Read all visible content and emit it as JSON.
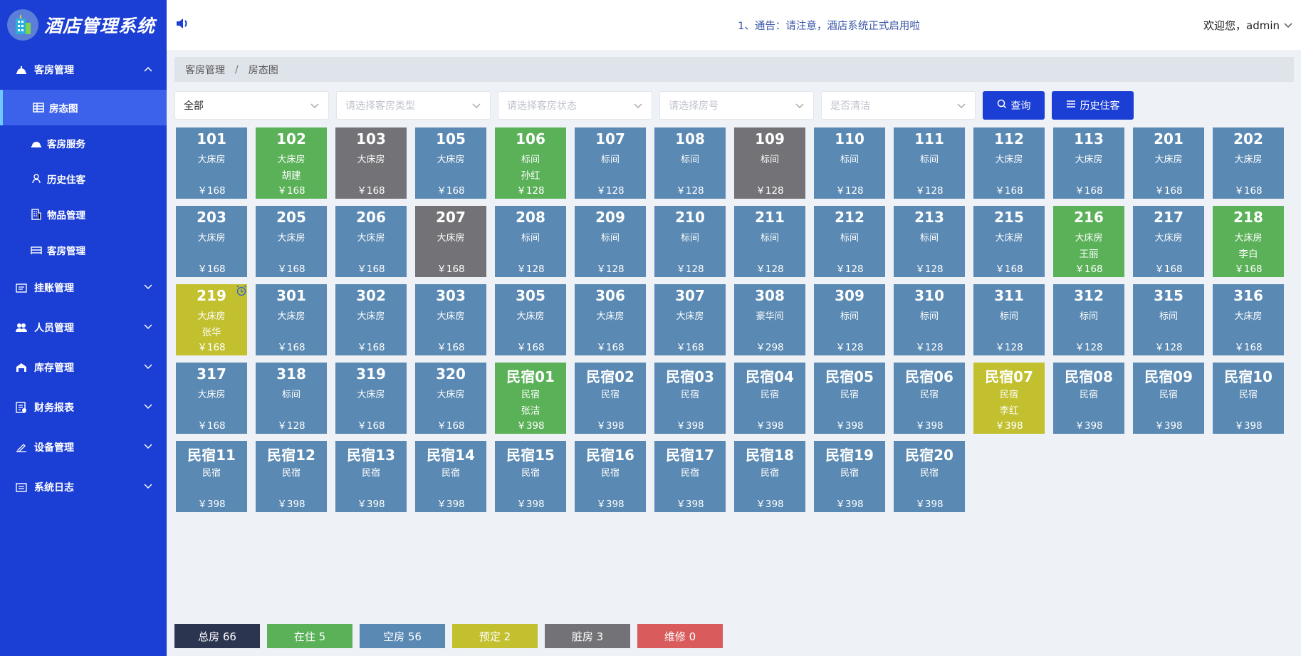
{
  "app": {
    "title": "酒店管理系统"
  },
  "colors": {
    "sidebar": "#1b3ed4",
    "empty": "#5a89b3",
    "occupied": "#5ab158",
    "reserved": "#c2c02f",
    "dirty": "#737276",
    "total": "#2c3550",
    "maintenance": "#d95b5b"
  },
  "sidebar": {
    "groups": [
      {
        "label": "客房管理",
        "icon": "hotel-bell-icon",
        "arrow": "up",
        "items": [
          {
            "label": "房态图",
            "icon": "table-grid-icon",
            "active": true
          },
          {
            "label": "客房服务",
            "icon": "service-bell-icon"
          },
          {
            "label": "历史住客",
            "icon": "user-icon"
          },
          {
            "label": "物品管理",
            "icon": "building-icon"
          },
          {
            "label": "客房管理",
            "icon": "bed-icon"
          }
        ]
      },
      {
        "label": "挂账管理",
        "icon": "ledger-icon",
        "arrow": "down"
      },
      {
        "label": "人员管理",
        "icon": "people-icon",
        "arrow": "down"
      },
      {
        "label": "库存管理",
        "icon": "warehouse-icon",
        "arrow": "down"
      },
      {
        "label": "财务报表",
        "icon": "report-icon",
        "arrow": "down"
      },
      {
        "label": "设备管理",
        "icon": "pen-icon",
        "arrow": "down"
      },
      {
        "label": "系统日志",
        "icon": "log-icon",
        "arrow": "down"
      }
    ]
  },
  "topbar": {
    "notice": "1、通告：请注意，酒店系统正式启用啦",
    "user_greeting": "欢迎您，admin"
  },
  "breadcrumb": [
    "客房管理",
    "房态图"
  ],
  "filters": {
    "selects": [
      {
        "value": "全部",
        "placeholder": ""
      },
      {
        "value": "",
        "placeholder": "请选择客房类型"
      },
      {
        "value": "",
        "placeholder": "请选择客房状态"
      },
      {
        "value": "",
        "placeholder": "请选择房号"
      },
      {
        "value": "",
        "placeholder": "是否清洁"
      }
    ],
    "query_label": "查询",
    "history_label": "历史住客"
  },
  "rooms": [
    {
      "num": "101",
      "type": "大床房",
      "guest": "",
      "price": "￥168",
      "status": "empty"
    },
    {
      "num": "102",
      "type": "大床房",
      "guest": "胡建",
      "price": "￥168",
      "status": "occupied"
    },
    {
      "num": "103",
      "type": "大床房",
      "guest": "",
      "price": "￥168",
      "status": "dirty"
    },
    {
      "num": "105",
      "type": "大床房",
      "guest": "",
      "price": "￥168",
      "status": "empty"
    },
    {
      "num": "106",
      "type": "标间",
      "guest": "孙红",
      "price": "￥128",
      "status": "occupied"
    },
    {
      "num": "107",
      "type": "标间",
      "guest": "",
      "price": "￥128",
      "status": "empty"
    },
    {
      "num": "108",
      "type": "标间",
      "guest": "",
      "price": "￥128",
      "status": "empty"
    },
    {
      "num": "109",
      "type": "标间",
      "guest": "",
      "price": "￥128",
      "status": "dirty"
    },
    {
      "num": "110",
      "type": "标间",
      "guest": "",
      "price": "￥128",
      "status": "empty"
    },
    {
      "num": "111",
      "type": "标间",
      "guest": "",
      "price": "￥128",
      "status": "empty"
    },
    {
      "num": "112",
      "type": "大床房",
      "guest": "",
      "price": "￥168",
      "status": "empty"
    },
    {
      "num": "113",
      "type": "大床房",
      "guest": "",
      "price": "￥168",
      "status": "empty"
    },
    {
      "num": "201",
      "type": "大床房",
      "guest": "",
      "price": "￥168",
      "status": "empty"
    },
    {
      "num": "202",
      "type": "大床房",
      "guest": "",
      "price": "￥168",
      "status": "empty"
    },
    {
      "num": "203",
      "type": "大床房",
      "guest": "",
      "price": "￥168",
      "status": "empty"
    },
    {
      "num": "205",
      "type": "大床房",
      "guest": "",
      "price": "￥168",
      "status": "empty"
    },
    {
      "num": "206",
      "type": "大床房",
      "guest": "",
      "price": "￥168",
      "status": "empty"
    },
    {
      "num": "207",
      "type": "大床房",
      "guest": "",
      "price": "￥168",
      "status": "dirty"
    },
    {
      "num": "208",
      "type": "标间",
      "guest": "",
      "price": "￥128",
      "status": "empty"
    },
    {
      "num": "209",
      "type": "标间",
      "guest": "",
      "price": "￥128",
      "status": "empty"
    },
    {
      "num": "210",
      "type": "标间",
      "guest": "",
      "price": "￥128",
      "status": "empty"
    },
    {
      "num": "211",
      "type": "标间",
      "guest": "",
      "price": "￥128",
      "status": "empty"
    },
    {
      "num": "212",
      "type": "标间",
      "guest": "",
      "price": "￥128",
      "status": "empty"
    },
    {
      "num": "213",
      "type": "标间",
      "guest": "",
      "price": "￥128",
      "status": "empty"
    },
    {
      "num": "215",
      "type": "大床房",
      "guest": "",
      "price": "￥168",
      "status": "empty"
    },
    {
      "num": "216",
      "type": "大床房",
      "guest": "王丽",
      "price": "￥168",
      "status": "occupied"
    },
    {
      "num": "217",
      "type": "大床房",
      "guest": "",
      "price": "￥168",
      "status": "empty"
    },
    {
      "num": "218",
      "type": "大床房",
      "guest": "李白",
      "price": "￥168",
      "status": "occupied"
    },
    {
      "num": "219",
      "type": "大床房",
      "guest": "张华",
      "price": "￥168",
      "status": "reserved",
      "alarm": true
    },
    {
      "num": "301",
      "type": "大床房",
      "guest": "",
      "price": "￥168",
      "status": "empty"
    },
    {
      "num": "302",
      "type": "大床房",
      "guest": "",
      "price": "￥168",
      "status": "empty"
    },
    {
      "num": "303",
      "type": "大床房",
      "guest": "",
      "price": "￥168",
      "status": "empty"
    },
    {
      "num": "305",
      "type": "大床房",
      "guest": "",
      "price": "￥168",
      "status": "empty"
    },
    {
      "num": "306",
      "type": "大床房",
      "guest": "",
      "price": "￥168",
      "status": "empty"
    },
    {
      "num": "307",
      "type": "大床房",
      "guest": "",
      "price": "￥168",
      "status": "empty"
    },
    {
      "num": "308",
      "type": "豪华间",
      "guest": "",
      "price": "￥298",
      "status": "empty"
    },
    {
      "num": "309",
      "type": "标间",
      "guest": "",
      "price": "￥128",
      "status": "empty"
    },
    {
      "num": "310",
      "type": "标间",
      "guest": "",
      "price": "￥128",
      "status": "empty"
    },
    {
      "num": "311",
      "type": "标间",
      "guest": "",
      "price": "￥128",
      "status": "empty"
    },
    {
      "num": "312",
      "type": "标间",
      "guest": "",
      "price": "￥128",
      "status": "empty"
    },
    {
      "num": "315",
      "type": "标间",
      "guest": "",
      "price": "￥128",
      "status": "empty"
    },
    {
      "num": "316",
      "type": "大床房",
      "guest": "",
      "price": "￥168",
      "status": "empty"
    },
    {
      "num": "317",
      "type": "大床房",
      "guest": "",
      "price": "￥168",
      "status": "empty"
    },
    {
      "num": "318",
      "type": "标间",
      "guest": "",
      "price": "￥128",
      "status": "empty"
    },
    {
      "num": "319",
      "type": "大床房",
      "guest": "",
      "price": "￥168",
      "status": "empty"
    },
    {
      "num": "320",
      "type": "大床房",
      "guest": "",
      "price": "￥168",
      "status": "empty"
    },
    {
      "num": "民宿01",
      "type": "民宿",
      "guest": "张洁",
      "price": "￥398",
      "status": "occupied"
    },
    {
      "num": "民宿02",
      "type": "民宿",
      "guest": "",
      "price": "￥398",
      "status": "empty"
    },
    {
      "num": "民宿03",
      "type": "民宿",
      "guest": "",
      "price": "￥398",
      "status": "empty"
    },
    {
      "num": "民宿04",
      "type": "民宿",
      "guest": "",
      "price": "￥398",
      "status": "empty"
    },
    {
      "num": "民宿05",
      "type": "民宿",
      "guest": "",
      "price": "￥398",
      "status": "empty"
    },
    {
      "num": "民宿06",
      "type": "民宿",
      "guest": "",
      "price": "￥398",
      "status": "empty"
    },
    {
      "num": "民宿07",
      "type": "民宿",
      "guest": "李红",
      "price": "￥398",
      "status": "reserved"
    },
    {
      "num": "民宿08",
      "type": "民宿",
      "guest": "",
      "price": "￥398",
      "status": "empty"
    },
    {
      "num": "民宿09",
      "type": "民宿",
      "guest": "",
      "price": "￥398",
      "status": "empty"
    },
    {
      "num": "民宿10",
      "type": "民宿",
      "guest": "",
      "price": "￥398",
      "status": "empty"
    },
    {
      "num": "民宿11",
      "type": "民宿",
      "guest": "",
      "price": "￥398",
      "status": "empty"
    },
    {
      "num": "民宿12",
      "type": "民宿",
      "guest": "",
      "price": "￥398",
      "status": "empty"
    },
    {
      "num": "民宿13",
      "type": "民宿",
      "guest": "",
      "price": "￥398",
      "status": "empty"
    },
    {
      "num": "民宿14",
      "type": "民宿",
      "guest": "",
      "price": "￥398",
      "status": "empty"
    },
    {
      "num": "民宿15",
      "type": "民宿",
      "guest": "",
      "price": "￥398",
      "status": "empty"
    },
    {
      "num": "民宿16",
      "type": "民宿",
      "guest": "",
      "price": "￥398",
      "status": "empty"
    },
    {
      "num": "民宿17",
      "type": "民宿",
      "guest": "",
      "price": "￥398",
      "status": "empty"
    },
    {
      "num": "民宿18",
      "type": "民宿",
      "guest": "",
      "price": "￥398",
      "status": "empty"
    },
    {
      "num": "民宿19",
      "type": "民宿",
      "guest": "",
      "price": "￥398",
      "status": "empty"
    },
    {
      "num": "民宿20",
      "type": "民宿",
      "guest": "",
      "price": "￥398",
      "status": "empty"
    }
  ],
  "legend": [
    {
      "label": "总房 66",
      "color": "#2c3550"
    },
    {
      "label": "在住 5",
      "color": "#5ab158"
    },
    {
      "label": "空房 56",
      "color": "#5a89b3"
    },
    {
      "label": "预定 2",
      "color": "#c2c02f"
    },
    {
      "label": "脏房 3",
      "color": "#737276"
    },
    {
      "label": "维修 0",
      "color": "#d95b5b"
    }
  ]
}
